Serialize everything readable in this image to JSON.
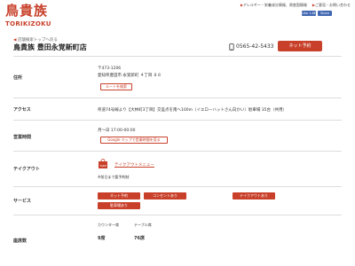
{
  "header": {
    "logo_jp": "鳥貴族",
    "logo_en": "TORIKIZOKU",
    "links": [
      "アレルギー・栄養成分情報、原産国情報",
      "ご意見・お問い合わせ"
    ],
    "fb_like": "Like 1.6K",
    "fb_share": "Share"
  },
  "breadcrumb": "店舗検索トップへ戻る",
  "store": {
    "title": "鳥貴族 豊田永覚新町店",
    "phone": "0565-42-5433",
    "reserve_label": "ネット予約"
  },
  "rows": {
    "address": {
      "label": "住所",
      "postal": "〒473-1206",
      "line": "愛知県豊田市 永覚新町 ４丁目 ８８",
      "route_btn": "ルートを検索"
    },
    "access": {
      "label": "アクセス",
      "text": "県道74号線より【大林町3丁目】交差点を南へ100m（イエローハットさん向かい）駐車場 35台（共用）"
    },
    "hours": {
      "label": "営業時間",
      "text": "月〜日 17:00-00:00",
      "google_btn": "Google マップで営業時間を見る"
    },
    "takeout": {
      "label": "テイクアウト",
      "link": "テイクアウトメニュー",
      "note": "※前日まで要予約制"
    },
    "services": {
      "label": "サービス",
      "items": [
        "ネット予約",
        "コンセントあり",
        "テイクアウトあり",
        "駐車場あり"
      ]
    },
    "seats": {
      "label": "座席数",
      "counter_label": "カウンター席",
      "counter_value": "9席",
      "table_label": "テーブル席",
      "table_value": "76席"
    }
  }
}
